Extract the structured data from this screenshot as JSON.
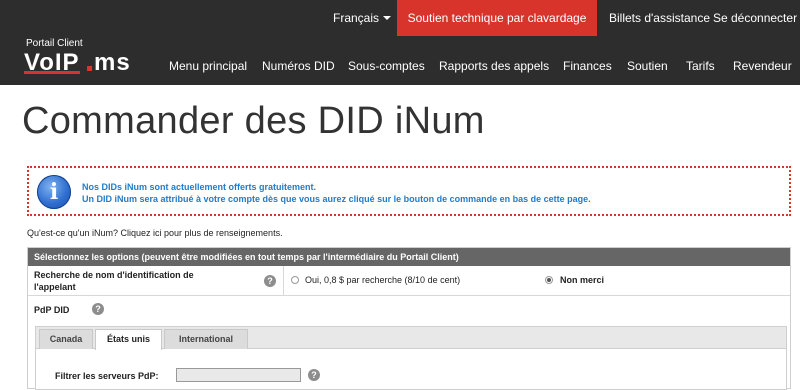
{
  "topbar": {
    "language": "Français",
    "chat_support": "Soutien technique par clavardage",
    "tickets": "Billets d'assistance",
    "logout": "Se déconnecter"
  },
  "brand": {
    "portal_label": "Portail Client",
    "logo_text": "VoIP.ms"
  },
  "nav": {
    "items": [
      "Menu principal",
      "Numéros DID",
      "Sous-comptes",
      "Rapports des appels",
      "Finances",
      "Soutien",
      "Tarifs",
      "Revendeur"
    ]
  },
  "page": {
    "title": "Commander des DID iNum"
  },
  "notice": {
    "line1": "Nos DIDs iNum sont actuellement offerts gratuitement.",
    "line2": "Un DID iNum sera attribué à votre compte dès que vous aurez cliqué sur le bouton de commande en bas de cette page."
  },
  "info_link": "Qu'est-ce qu'un iNum? Cliquez ici pour plus de renseignements.",
  "options": {
    "header": "Sélectionnez les options (peuvent être modifiées en tout temps par l'intermédiaire du Portail Client)",
    "callerid": {
      "label_line1": "Recherche de nom d'identification de",
      "label_line2": "l'appelant",
      "option_yes": "Oui, 0,8 $ par recherche (8/10 de cent)",
      "option_no": "Non merci",
      "selected": "no"
    },
    "pop": {
      "label": "PdP DID",
      "tabs": [
        "Canada",
        "États unis",
        "International"
      ],
      "active_tab": "États unis",
      "filter_label": "Filtrer les serveurs PdP:",
      "filter_value": ""
    }
  },
  "colors": {
    "header_bg": "#2d2d2d",
    "accent_red": "#d9342c",
    "notice_blue": "#1f7ccc",
    "table_header": "#666666"
  }
}
